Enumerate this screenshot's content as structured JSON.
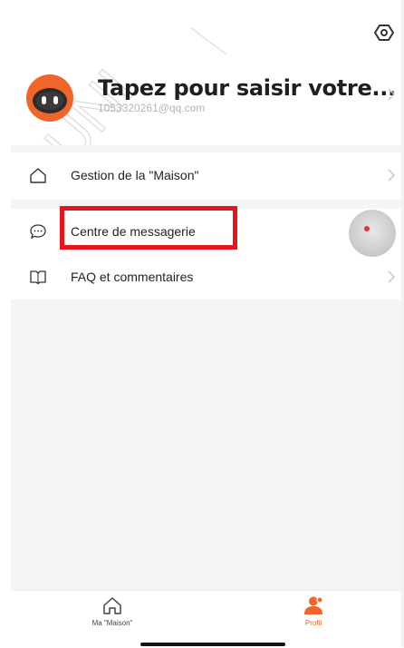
{
  "header": {
    "profile_name": "Tapez pour saisir votre...",
    "email": "1053320261@qq.com"
  },
  "menu": {
    "home_management": "Gestion de la \"Maison\"",
    "message_center": "Centre de messagerie",
    "faq": "FAQ et commentaires"
  },
  "watermark": {
    "text": "HUNI"
  },
  "tabbar": {
    "home_label": "Ma \"Maison\"",
    "profile_label": "Profil"
  },
  "colors": {
    "accent": "#f0652a",
    "highlight": "#e8141c",
    "background": "#f5f5f7"
  }
}
